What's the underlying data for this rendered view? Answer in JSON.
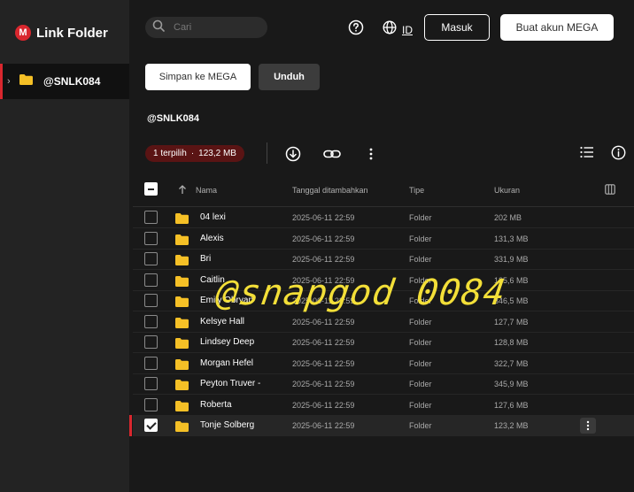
{
  "app": {
    "logo_letter": "M",
    "title": "Link Folder"
  },
  "sidebar": {
    "items": [
      {
        "label": "@SNLK084"
      }
    ]
  },
  "header": {
    "search_placeholder": "Cari",
    "lang_label": "ID",
    "login_label": "Masuk",
    "create_account_label": "Buat akun MEGA"
  },
  "actions": {
    "save_label": "Simpan ke MEGA",
    "download_label": "Unduh"
  },
  "folder": {
    "name": "@SNLK084"
  },
  "selection": {
    "count_label": "1 terpilih",
    "separator": "·",
    "size_label": "123,2 MB"
  },
  "table": {
    "columns": {
      "name": "Nama",
      "date": "Tanggal ditambahkan",
      "type": "Tipe",
      "size": "Ukuran"
    },
    "rows": [
      {
        "name": "04 lexi",
        "date": "2025-06-11 22:59",
        "type": "Folder",
        "size": "202 MB"
      },
      {
        "name": "Alexis",
        "date": "2025-06-11 22:59",
        "type": "Folder",
        "size": "131,3 MB"
      },
      {
        "name": "Bri",
        "date": "2025-06-11 22:59",
        "type": "Folder",
        "size": "331,9 MB"
      },
      {
        "name": "Caitlin",
        "date": "2025-06-11 22:59",
        "type": "Folder",
        "size": "135,6 MB"
      },
      {
        "name": "Emily Obryan",
        "date": "2025-06-11 22:59",
        "type": "Folder",
        "size": "346,5 MB"
      },
      {
        "name": "Kelsye Hall",
        "date": "2025-06-11 22:59",
        "type": "Folder",
        "size": "127,7 MB"
      },
      {
        "name": "Lindsey Deep",
        "date": "2025-06-11 22:59",
        "type": "Folder",
        "size": "128,8 MB"
      },
      {
        "name": "Morgan Hefel",
        "date": "2025-06-11 22:59",
        "type": "Folder",
        "size": "322,7 MB"
      },
      {
        "name": "Peyton Truver -",
        "date": "2025-06-11 22:59",
        "type": "Folder",
        "size": "345,9 MB"
      },
      {
        "name": "Roberta",
        "date": "2025-06-11 22:59",
        "type": "Folder",
        "size": "127,6 MB"
      },
      {
        "name": "Tonje Solberg",
        "date": "2025-06-11 22:59",
        "type": "Folder",
        "size": "123,2 MB"
      }
    ]
  },
  "watermark": {
    "text": "@snapgod 0084"
  },
  "colors": {
    "accent": "#d9272e",
    "folder": "#f5c026",
    "watermark": "#f3df38",
    "selection_badge": "#5a1414"
  }
}
